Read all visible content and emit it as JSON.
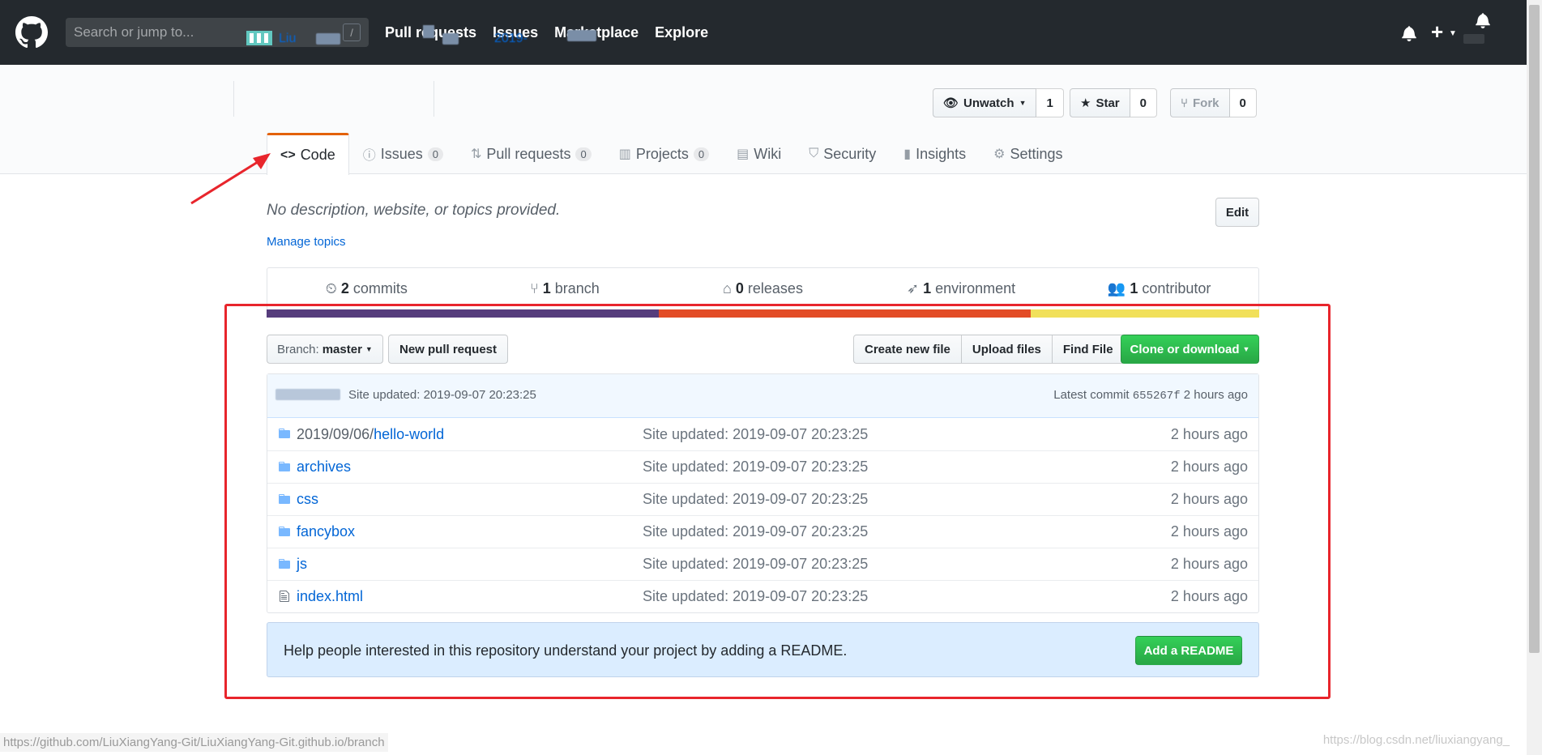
{
  "header": {
    "search_placeholder": "Search or jump to...",
    "slash_key": "/",
    "nav": [
      "Pull requests",
      "Issues",
      "Marketplace",
      "Explore"
    ],
    "plus_label": "+",
    "brand_color": "#24292e"
  },
  "repo": {
    "owner": "Liu",
    "name": "2019-",
    "watch": {
      "label": "Unwatch",
      "count": "1"
    },
    "star": {
      "label": "Star",
      "count": "0"
    },
    "fork": {
      "label": "Fork",
      "count": "0"
    }
  },
  "reponav": [
    {
      "label": "Code",
      "counter": null,
      "icon": "code-icon"
    },
    {
      "label": "Issues",
      "counter": "0",
      "icon": "issue-icon"
    },
    {
      "label": "Pull requests",
      "counter": "0",
      "icon": "git-pull-request-icon"
    },
    {
      "label": "Projects",
      "counter": "0",
      "icon": "project-icon"
    },
    {
      "label": "Wiki",
      "counter": null,
      "icon": "book-icon"
    },
    {
      "label": "Security",
      "counter": null,
      "icon": "shield-icon"
    },
    {
      "label": "Insights",
      "counter": null,
      "icon": "graph-icon"
    },
    {
      "label": "Settings",
      "counter": null,
      "icon": "gear-icon"
    }
  ],
  "description": "No description, website, or topics provided.",
  "manage_topics": "Manage topics",
  "edit_label": "Edit",
  "summary": {
    "commits": {
      "num": "2",
      "label": "commits"
    },
    "branch": {
      "num": "1",
      "label": "branch"
    },
    "releases": {
      "num": "0",
      "label": "releases"
    },
    "environment": {
      "num": "1",
      "label": "environment"
    },
    "contributor": {
      "num": "1",
      "label": "contributor"
    }
  },
  "language_bar": [
    {
      "color": "#563d7c",
      "share": 39.5
    },
    {
      "color": "#e34c26",
      "share": 37.5
    },
    {
      "color": "#f1e05a",
      "share": 23.0
    }
  ],
  "file_nav": {
    "branch_prefix": "Branch:",
    "branch_name": "master",
    "new_pr": "New pull request",
    "create_file": "Create new file",
    "upload_files": "Upload files",
    "find_file": "Find File",
    "clone": "Clone or download"
  },
  "commit_tease": {
    "message": "Site updated: 2019-09-07 20:23:25",
    "latest_prefix": "Latest commit",
    "sha": "655267f",
    "age": "2 hours ago"
  },
  "files": [
    {
      "type": "dir",
      "prefix": "2019/09/06/",
      "name": "hello-world",
      "message": "Site updated: 2019-09-07 20:23:25",
      "age": "2 hours ago"
    },
    {
      "type": "dir",
      "prefix": "",
      "name": "archives",
      "message": "Site updated: 2019-09-07 20:23:25",
      "age": "2 hours ago"
    },
    {
      "type": "dir",
      "prefix": "",
      "name": "css",
      "message": "Site updated: 2019-09-07 20:23:25",
      "age": "2 hours ago"
    },
    {
      "type": "dir",
      "prefix": "",
      "name": "fancybox",
      "message": "Site updated: 2019-09-07 20:23:25",
      "age": "2 hours ago"
    },
    {
      "type": "dir",
      "prefix": "",
      "name": "js",
      "message": "Site updated: 2019-09-07 20:23:25",
      "age": "2 hours ago"
    },
    {
      "type": "file",
      "prefix": "",
      "name": "index.html",
      "message": "Site updated: 2019-09-07 20:23:25",
      "age": "2 hours ago"
    }
  ],
  "readme": {
    "text": "Help people interested in this repository understand your project by adding a README.",
    "button": "Add a README"
  },
  "status_url": "https://github.com/LiuXiangYang-Git/LiuXiangYang-Git.github.io/branch",
  "watermark": "https://blog.csdn.net/liuxiangyang_"
}
